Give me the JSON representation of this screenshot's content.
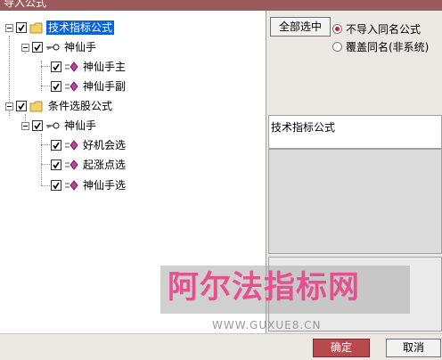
{
  "window": {
    "title": "导入公式"
  },
  "tree": {
    "root1": {
      "label": "技术指标公式"
    },
    "group1": {
      "label": "神仙手"
    },
    "item1": {
      "label": "神仙手主"
    },
    "item2": {
      "label": "神仙手副"
    },
    "root2": {
      "label": "条件选股公式"
    },
    "group2": {
      "label": "神仙手"
    },
    "item3": {
      "label": "好机会选"
    },
    "item4": {
      "label": "起涨点选"
    },
    "item5": {
      "label": "神仙手选"
    }
  },
  "options": {
    "select_all_label": "全部选中",
    "radio1_label": "不导入同名公式",
    "radio2_label": "覆盖同名(非系统)",
    "selected": "不导入同名公式"
  },
  "info": {
    "type_label": "技术指标公式"
  },
  "footer": {
    "ok_label": "确定",
    "cancel_label": "取消"
  },
  "watermark": {
    "text": "阿尔法指标网",
    "url": "WWW.GUXUE8.CN"
  },
  "colors": {
    "titlebar": "#9c5a5c",
    "selection": "#0a64d8",
    "ok_button": "#b84a4e",
    "watermark_text": "#e6508f"
  }
}
